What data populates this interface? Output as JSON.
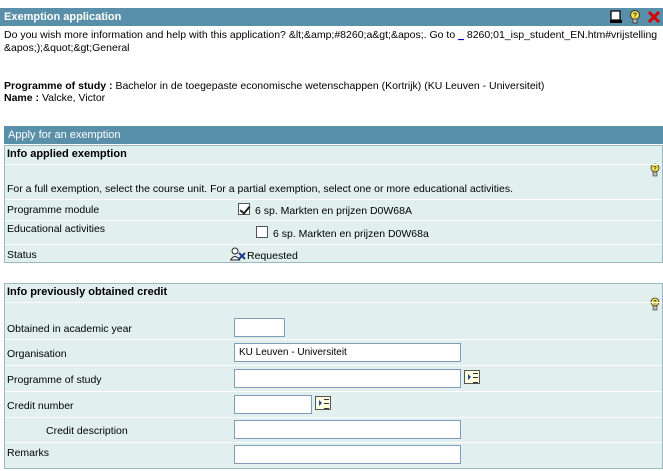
{
  "header": {
    "title": "Exemption application",
    "icons": [
      "print-icon",
      "help-bulb-icon",
      "close-icon"
    ]
  },
  "help": {
    "prefix": "Do you wish more information and help with this application? &lt;&amp;#8260;a&gt;&apos;. Go to ",
    "link_text": "_",
    "suffix": " 8260;01_isp_student_EN.htm#vrijstelling &apos;);&quot;&gt;General"
  },
  "programme": {
    "label": "Programme of study :",
    "value": "Bachelor in de toegepaste economische wetenschappen (Kortrijk) (KU Leuven - Universiteit)",
    "name_label": "Name :",
    "name_value": "Valcke, Victor"
  },
  "apply_section": {
    "title": "Apply for an exemption"
  },
  "info_applied": {
    "title": "Info applied exemption",
    "instruction": "For a full exemption, select the course unit. For a partial exemption, select one or more educational activities.",
    "module_label": "Programme module",
    "module_option": "6 sp. Markten en prijzen D0W68A",
    "module_checked": true,
    "activities_label": "Educational activities",
    "activity_option": "6 sp. Markten en prijzen D0W68a",
    "activity_checked": false,
    "status_label": "Status",
    "status_value": "Requested"
  },
  "info_previous": {
    "title": "Info previously obtained credit",
    "year_label": "Obtained in academic year",
    "year_value": "",
    "org_label": "Organisation",
    "org_value": "KU Leuven - Universiteit",
    "prog_label": "Programme of study",
    "prog_value": "",
    "credit_label": "Credit number",
    "credit_value": "",
    "desc_label": "Credit description",
    "desc_value": "",
    "remarks_label": "Remarks",
    "remarks_value": ""
  },
  "colors": {
    "header_bg": "#5a8fa9",
    "panel_bg": "#e1f0ef"
  }
}
